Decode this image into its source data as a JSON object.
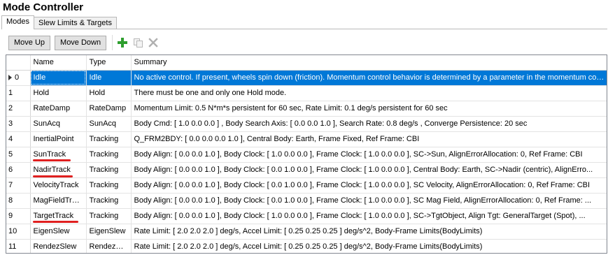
{
  "window": {
    "title": "Mode Controller"
  },
  "tabs": [
    {
      "label": "Modes",
      "active": true
    },
    {
      "label": "Slew Limits & Targets",
      "active": false
    }
  ],
  "toolbar": {
    "move_up": "Move Up",
    "move_down": "Move Down",
    "icons": [
      "add-icon",
      "copy-icon",
      "delete-icon"
    ]
  },
  "grid": {
    "columns": [
      "",
      "Name",
      "Type",
      "Summary"
    ],
    "selected_index": 0,
    "rows": [
      {
        "index": "0",
        "name": "Idle",
        "type": "Idle",
        "summary": "No active control.  If present, wheels spin down (friction).  Momentum control behavior is determined by a parameter in the momentum contr..."
      },
      {
        "index": "1",
        "name": "Hold",
        "type": "Hold",
        "summary": "There must be one and only one Hold mode."
      },
      {
        "index": "2",
        "name": "RateDamp",
        "type": "RateDamp",
        "summary": "Momentum Limit:  0.5 N*m*s persistent for 60  sec, Rate Limit:  0.1  deg/s persistent for 60 sec"
      },
      {
        "index": "3",
        "name": "SunAcq",
        "type": "SunAcq",
        "summary": "Body Cmd:  [ 1.0  0.0  0.0 ] , Body Search Axis:  [ 0.0  0.0  1.0 ], Search Rate:  0.8 deg/s , Converge Persistence:  20 sec"
      },
      {
        "index": "4",
        "name": "InertialPoint",
        "type": "Tracking",
        "summary": "Q_FRM2BDY:  [ 0.0  0.0  0.0  1.0 ], Central Body:  Earth, Frame Fixed, Ref Frame: CBI"
      },
      {
        "index": "5",
        "name": "SunTrack",
        "type": "Tracking",
        "summary": "Body Align:  [ 0.0  0.0  1.0 ], Body Clock:  [ 1.0  0.0  0.0 ], Frame Clock:  [ 1.0  0.0  0.0 ], SC->Sun, AlignErrorAllocation:  0, Ref Frame: CBI"
      },
      {
        "index": "6",
        "name": "NadirTrack",
        "type": "Tracking",
        "summary": "Body Align:  [ 0.0  0.0  1.0 ], Body Clock:  [ 0.0  1.0  0.0 ], Frame Clock:  [ 1.0  0.0  0.0 ], Central Body:  Earth, SC->Nadir (centric), AlignErro..."
      },
      {
        "index": "7",
        "name": "VelocityTrack",
        "type": "Tracking",
        "summary": "Body Align:  [ 0.0  0.0  1.0 ], Body Clock:  [ 0.0  1.0  0.0 ], Frame Clock:  [ 1.0  0.0  0.0 ], SC Velocity, AlignErrorAllocation:  0, Ref Frame: CBI"
      },
      {
        "index": "8",
        "name": "MagFieldTrack",
        "type": "Tracking",
        "summary": "Body Align:  [ 0.0  0.0  1.0 ], Body Clock:  [ 0.0  1.0  0.0 ], Frame Clock:  [ 1.0  0.0  0.0 ], SC Mag Field, AlignErrorAllocation:  0, Ref Frame: ..."
      },
      {
        "index": "9",
        "name": "TargetTrack",
        "type": "Tracking",
        "summary": "Body Align:  [ 0.0  0.0  1.0 ], Body Clock:  [ 1.0  0.0  0.0 ], Frame Clock:  [ 1.0  0.0  0.0 ], SC->TgtObject, Align Tgt:  GeneralTarget (Spot), ..."
      },
      {
        "index": "10",
        "name": "EigenSlew",
        "type": "EigenSlew",
        "summary": "Rate Limit:  [ 2.0  2.0  2.0 ] deg/s, Accel Limit:  [ 0.25  0.25  0.25 ] deg/s^2, Body-Frame Limits(BodyLimits)"
      },
      {
        "index": "11",
        "name": "RendezSlew",
        "type": "RendezSlew",
        "summary": "Rate Limit:  [ 2.0  2.0  2.0 ] deg/s, Accel Limit:  [ 0.25  0.25  0.25 ] deg/s^2, Body-Frame Limits(BodyLimits)"
      }
    ]
  },
  "colors": {
    "selection": "#0078d7",
    "annotation_underline": "#e02020",
    "add_icon": "#2e9e2e"
  }
}
